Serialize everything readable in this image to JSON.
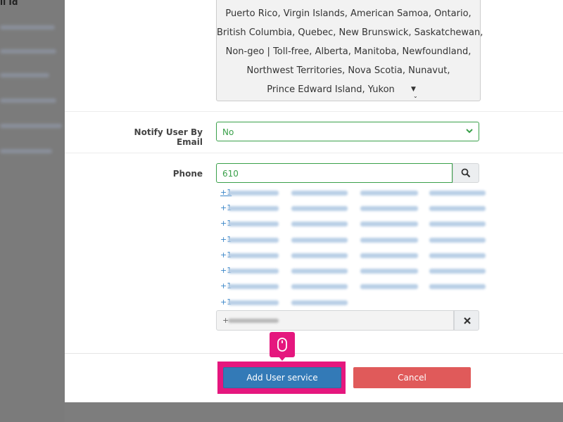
{
  "background": {
    "column_header": "il Id",
    "blurred_rows": 6
  },
  "states": {
    "lines": [
      "Puerto Rico,  Virgin Islands,  American Samoa,  Ontario,",
      "British Columbia,  Quebec,  New Brunswick,  Saskatchewan,",
      "Non-geo | Toll-free,  Alberta,  Manitoba,  Newfoundland,",
      "Northwest Territories,  Nova Scotia,  Nunavut,",
      "Prince Edward Island,  Yukon"
    ]
  },
  "notify": {
    "label": "Notify User By Email",
    "value": "No"
  },
  "phone": {
    "label": "Phone",
    "value": "610",
    "number_prefix": "+1",
    "selected_prefix": "+"
  },
  "footer": {
    "add_label": "Add User service",
    "cancel_label": "Cancel"
  },
  "colors": {
    "accent_green": "#3aa04a",
    "primary_blue": "#337ab7",
    "danger_red": "#e05a5a",
    "highlight_pink": "#e5177e",
    "link_blue": "#3a86c8"
  },
  "icons": [
    "chevron-down-icon",
    "search-icon",
    "close-icon",
    "mouse-icon",
    "caret-down-icon"
  ]
}
